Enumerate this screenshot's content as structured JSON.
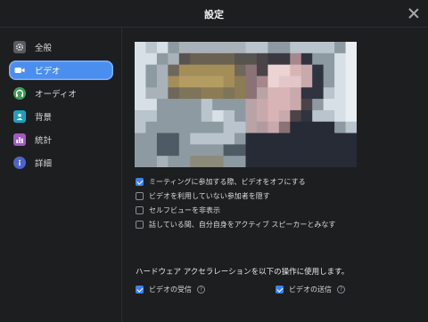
{
  "window": {
    "title": "設定"
  },
  "sidebar": {
    "items": [
      {
        "label": "全般",
        "icon": "gear-icon",
        "icon_color": "#c9c9cc",
        "active": false
      },
      {
        "label": "ビデオ",
        "icon": "video-camera-icon",
        "icon_color": "#ffffff",
        "active": true
      },
      {
        "label": "オーディオ",
        "icon": "headphones-icon",
        "icon_color": "#4fb56a",
        "active": false
      },
      {
        "label": "背景",
        "icon": "person-background-icon",
        "icon_color": "#23a8c9",
        "active": false
      },
      {
        "label": "統計",
        "icon": "bar-chart-icon",
        "icon_color": "#b46cc9",
        "active": false
      },
      {
        "label": "詳細",
        "icon": "info-icon",
        "icon_color": "#5f73d6",
        "active": false
      }
    ]
  },
  "video": {
    "options": [
      {
        "label": "ミーティングに参加する際、ビデオをオフにする",
        "checked": true
      },
      {
        "label": "ビデオを利用していない参加者を隠す",
        "checked": false
      },
      {
        "label": "セルフビューを非表示",
        "checked": false
      },
      {
        "label": "話している間、自分自身をアクティブ スピーカーとみなす",
        "checked": false
      }
    ],
    "hw_accel_label": "ハードウェア アクセラレーションを以下の操作に使用します。",
    "hw_options": [
      {
        "label": "ビデオの受信",
        "checked": true,
        "help": "?"
      },
      {
        "label": "ビデオの送信",
        "checked": true,
        "help": "?"
      }
    ]
  },
  "colors": {
    "accent": "#4a8ff0",
    "background": "#1d1e20"
  }
}
